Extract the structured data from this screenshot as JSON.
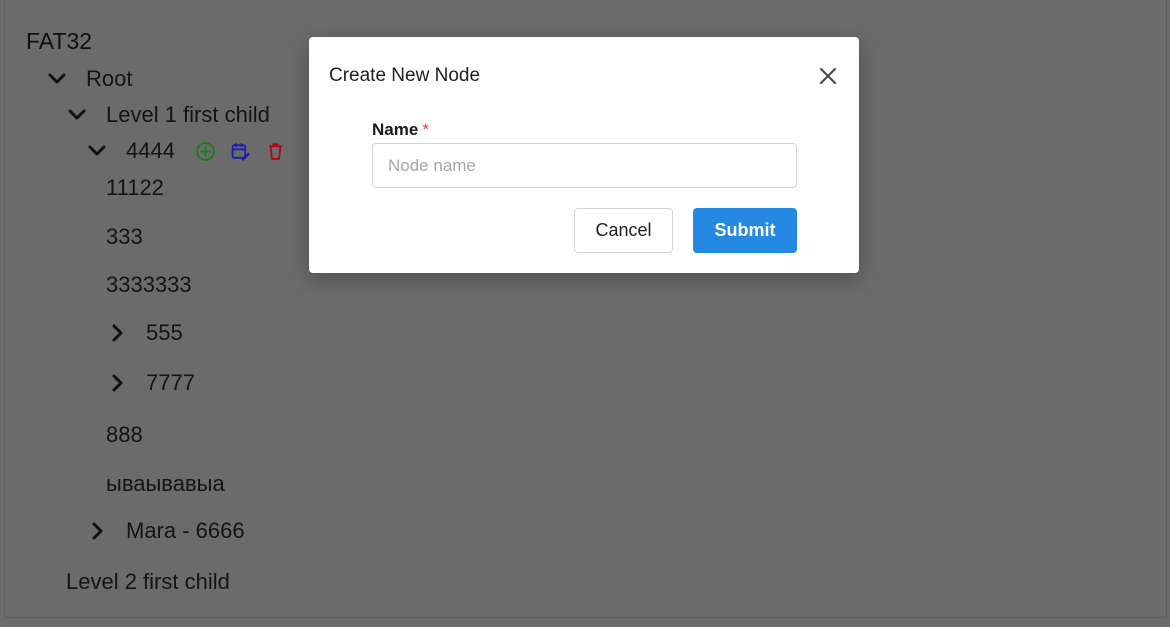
{
  "tree": {
    "title": "FAT32",
    "root": "Root",
    "level1": "Level 1 first child",
    "node4444": "4444",
    "leaf_11122": "11122",
    "leaf_333": "333",
    "leaf_3333333": "3333333",
    "node555": "555",
    "node7777": "7777",
    "leaf_888": "888",
    "leaf_cyr": "ываывавыа",
    "mara": "Mara - 6666",
    "level2": "Level 2 first child",
    "icons": {
      "collapse": "chevron-down-icon",
      "expand": "chevron-right-icon",
      "add": "plus-circle-icon",
      "edit": "calendar-edit-icon",
      "delete": "trash-icon"
    },
    "colors": {
      "add": "#1b7a1b",
      "edit": "#1c1cb8",
      "delete": "#b3001b"
    }
  },
  "modal": {
    "title": "Create New Node",
    "close_icon": "close-icon",
    "name_label": "Name",
    "required_mark": "*",
    "name_value": "",
    "name_placeholder": "Node name",
    "cancel_label": "Cancel",
    "submit_label": "Submit",
    "accent": "#2589e3"
  }
}
